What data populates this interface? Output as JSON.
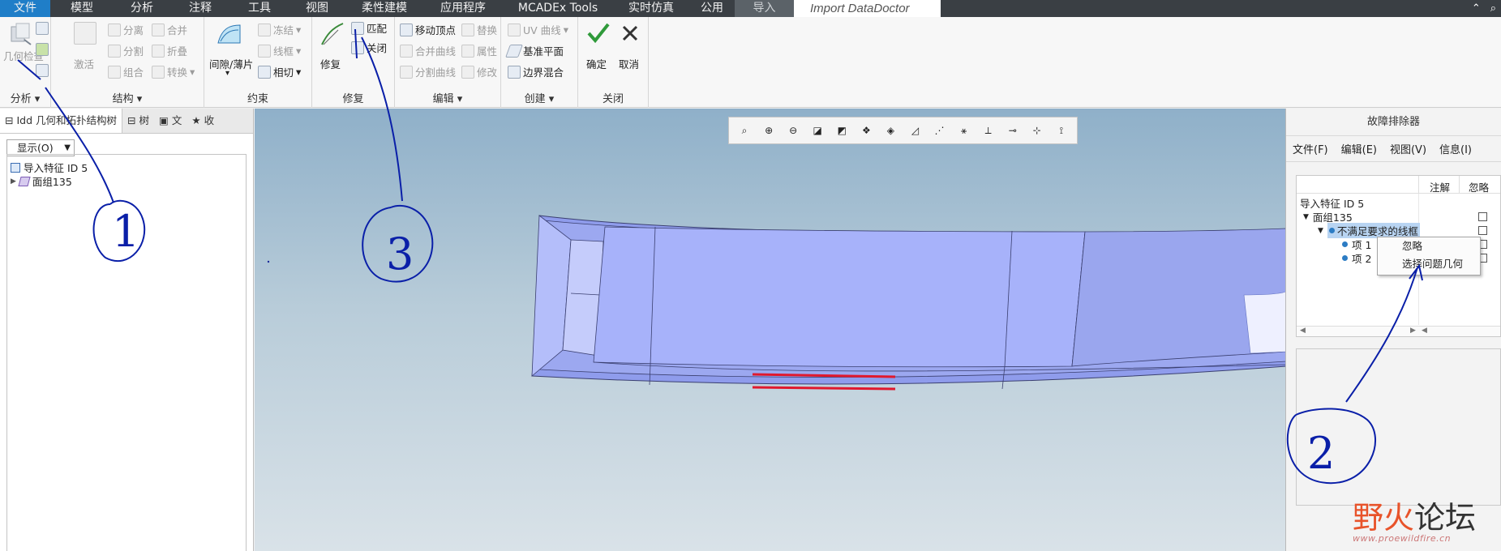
{
  "menubar": {
    "items": [
      "文件",
      "模型",
      "分析",
      "注释",
      "工具",
      "视图",
      "柔性建模",
      "应用程序",
      "MCADEx Tools",
      "实时仿真",
      "公用",
      "导入",
      "Import DataDoctor"
    ],
    "right_icons": [
      "caret-up-icon",
      "search-icon"
    ]
  },
  "ribbon": {
    "analysis": {
      "label": "分析",
      "btn_check": "几何检查"
    },
    "structure": {
      "label": "结构",
      "activate": "激活",
      "separate": "分离",
      "merge": "合并",
      "split": "分割",
      "fold": "折叠",
      "group": "组合",
      "convert": "转换"
    },
    "constraint": {
      "label": "约束",
      "gap": "间隙/薄片",
      "freeze": "冻结",
      "wireframe": "线框",
      "tangent": "相切"
    },
    "repair": {
      "label": "修复",
      "fix": "修复",
      "match": "匹配",
      "close": "关闭"
    },
    "edit": {
      "label": "编辑",
      "move_vertex": "移动顶点",
      "replace": "替换",
      "merge_curve": "合并曲线",
      "property": "属性",
      "split_curve": "分割曲线",
      "modify": "修改"
    },
    "create": {
      "label": "创建",
      "uv_curve": "UV 曲线",
      "datum_plane": "基准平面",
      "boundary_blend": "边界混合"
    },
    "close": {
      "label": "关闭",
      "ok": "确定",
      "cancel": "取消"
    }
  },
  "left_panel": {
    "tabs": [
      "Idd 几何和拓扑结构树",
      "树",
      "文",
      "收"
    ],
    "display_select": "显示(O)",
    "tree": [
      {
        "label": "导入特征 ID 5"
      },
      {
        "label": "面组135"
      }
    ]
  },
  "troubleshooter": {
    "title": "故障排除器",
    "menu": [
      "文件(F)",
      "编辑(E)",
      "视图(V)",
      "信息(I)"
    ],
    "columns": [
      "注解",
      "忽略"
    ],
    "rows": [
      "导入特征 ID 5",
      "面组135",
      "不满足要求的线框",
      "项 1",
      "项 2"
    ],
    "context_menu": [
      "忽略",
      "选择问题几何"
    ]
  },
  "annotations": [
    "1",
    "2",
    "3"
  ],
  "watermark": {
    "text_a": "野火",
    "text_b": "论坛",
    "url": "www.proewildfire.cn"
  },
  "colors": {
    "menu_bar": "#3a3f44",
    "file_tab": "#1f7ec8",
    "model_fill": "#a8b4f5",
    "highlight": "#e0192e",
    "annotation": "#0a1fa8"
  }
}
